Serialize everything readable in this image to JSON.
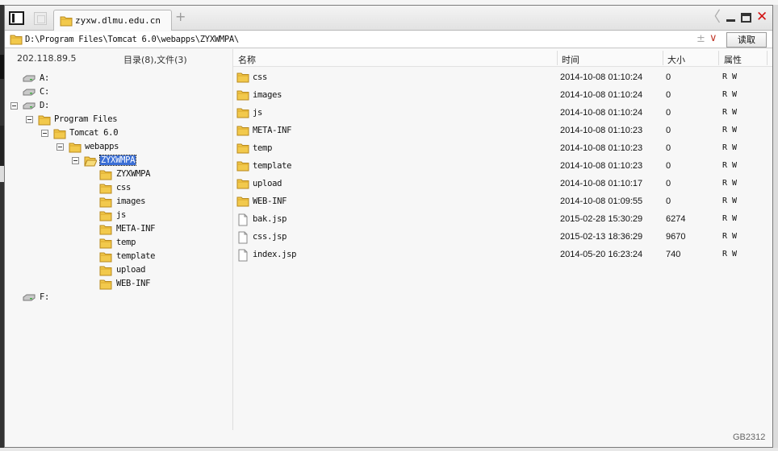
{
  "window": {
    "tab_title": "zyxw.dlmu.edu.cn",
    "add_tab": "+",
    "back": "〈",
    "close": "✕"
  },
  "address": {
    "path": "D:\\Program Files\\Tomcat 6.0\\webapps\\ZYXWMPA\\",
    "plus_minus": "±",
    "dropdown": "∨",
    "read_label": "读取"
  },
  "left_panel": {
    "host_ip": "202.118.89.5",
    "summary": "目录(8),文件(3)"
  },
  "tree": [
    {
      "label": "A:",
      "kind": "drive"
    },
    {
      "label": "C:",
      "kind": "drive"
    },
    {
      "label": "D:",
      "kind": "drive",
      "expanded": true
    },
    {
      "label": "Program Files",
      "kind": "folder",
      "expanded": true
    },
    {
      "label": "Tomcat 6.0",
      "kind": "folder",
      "expanded": true
    },
    {
      "label": "webapps",
      "kind": "folder",
      "expanded": true
    },
    {
      "label": "ZYXWMPA",
      "kind": "folder",
      "expanded": true,
      "selected": true
    },
    {
      "label": "ZYXWMPA",
      "kind": "folder"
    },
    {
      "label": "css",
      "kind": "folder"
    },
    {
      "label": "images",
      "kind": "folder"
    },
    {
      "label": "js",
      "kind": "folder"
    },
    {
      "label": "META-INF",
      "kind": "folder"
    },
    {
      "label": "temp",
      "kind": "folder"
    },
    {
      "label": "template",
      "kind": "folder"
    },
    {
      "label": "upload",
      "kind": "folder"
    },
    {
      "label": "WEB-INF",
      "kind": "folder"
    },
    {
      "label": "F:",
      "kind": "drive"
    }
  ],
  "columns": {
    "name": "名称",
    "time": "时间",
    "size": "大小",
    "attr": "属性"
  },
  "files": [
    {
      "name": "css",
      "type": "folder",
      "time": "2014-10-08 01:10:24",
      "size": "0",
      "attr": "R W"
    },
    {
      "name": "images",
      "type": "folder",
      "time": "2014-10-08 01:10:24",
      "size": "0",
      "attr": "R W"
    },
    {
      "name": "js",
      "type": "folder",
      "time": "2014-10-08 01:10:24",
      "size": "0",
      "attr": "R W"
    },
    {
      "name": "META-INF",
      "type": "folder",
      "time": "2014-10-08 01:10:23",
      "size": "0",
      "attr": "R W"
    },
    {
      "name": "temp",
      "type": "folder",
      "time": "2014-10-08 01:10:23",
      "size": "0",
      "attr": "R W"
    },
    {
      "name": "template",
      "type": "folder",
      "time": "2014-10-08 01:10:23",
      "size": "0",
      "attr": "R W"
    },
    {
      "name": "upload",
      "type": "folder",
      "time": "2014-10-08 01:10:17",
      "size": "0",
      "attr": "R W"
    },
    {
      "name": "WEB-INF",
      "type": "folder",
      "time": "2014-10-08 01:09:55",
      "size": "0",
      "attr": "R W"
    },
    {
      "name": "bak.jsp",
      "type": "file",
      "time": "2015-02-28 15:30:29",
      "size": "6274",
      "attr": "R W"
    },
    {
      "name": "css.jsp",
      "type": "file",
      "time": "2015-02-13 18:36:29",
      "size": "9670",
      "attr": "R W"
    },
    {
      "name": "index.jsp",
      "type": "file",
      "time": "2014-05-20 16:23:24",
      "size": "740",
      "attr": "R W"
    }
  ],
  "status": {
    "encoding": "GB2312"
  },
  "colors": {
    "selection": "#3b6fd6",
    "close": "#d21515",
    "folder": "#f2c94c"
  }
}
